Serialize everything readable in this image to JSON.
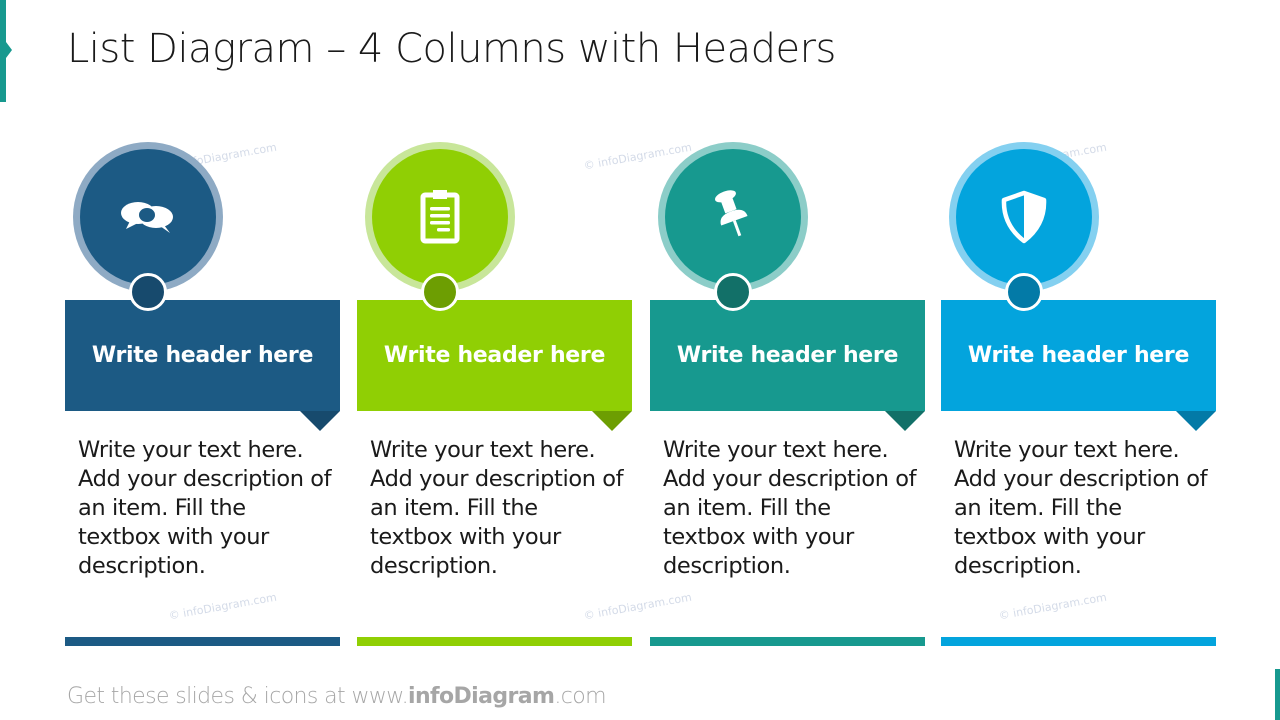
{
  "title": "List Diagram – 4 Columns with Headers",
  "watermark": "© infoDiagram.com",
  "columns": [
    {
      "icon": "speech-bubbles-icon",
      "header": "Write header here",
      "description": "Write your text here. Add your description of an item. Fill the textbox with your description.",
      "colors": {
        "main": "#1c5a84",
        "ring": "#8eaac4",
        "dark": "#174a6d"
      }
    },
    {
      "icon": "clipboard-icon",
      "header": "Write header here",
      "description": "Write your text here. Add your description of an item. Fill the textbox with your description.",
      "colors": {
        "main": "#90cf04",
        "ring": "#c8e69a",
        "dark": "#6d9e02"
      }
    },
    {
      "icon": "pushpin-icon",
      "header": "Write header here",
      "description": "Write your text here. Add your description of an item. Fill the textbox with your description.",
      "colors": {
        "main": "#17998f",
        "ring": "#8ccdc8",
        "dark": "#127068"
      }
    },
    {
      "icon": "shield-icon",
      "header": "Write header here",
      "description": "Write your text here. Add your description of an item. Fill the textbox with your description.",
      "colors": {
        "main": "#03a4dd",
        "ring": "#84d0f0",
        "dark": "#037aa7"
      }
    }
  ],
  "footer": {
    "prefix": "Get these slides & icons at www.",
    "brand": "infoDiagram",
    "suffix": ".com"
  }
}
